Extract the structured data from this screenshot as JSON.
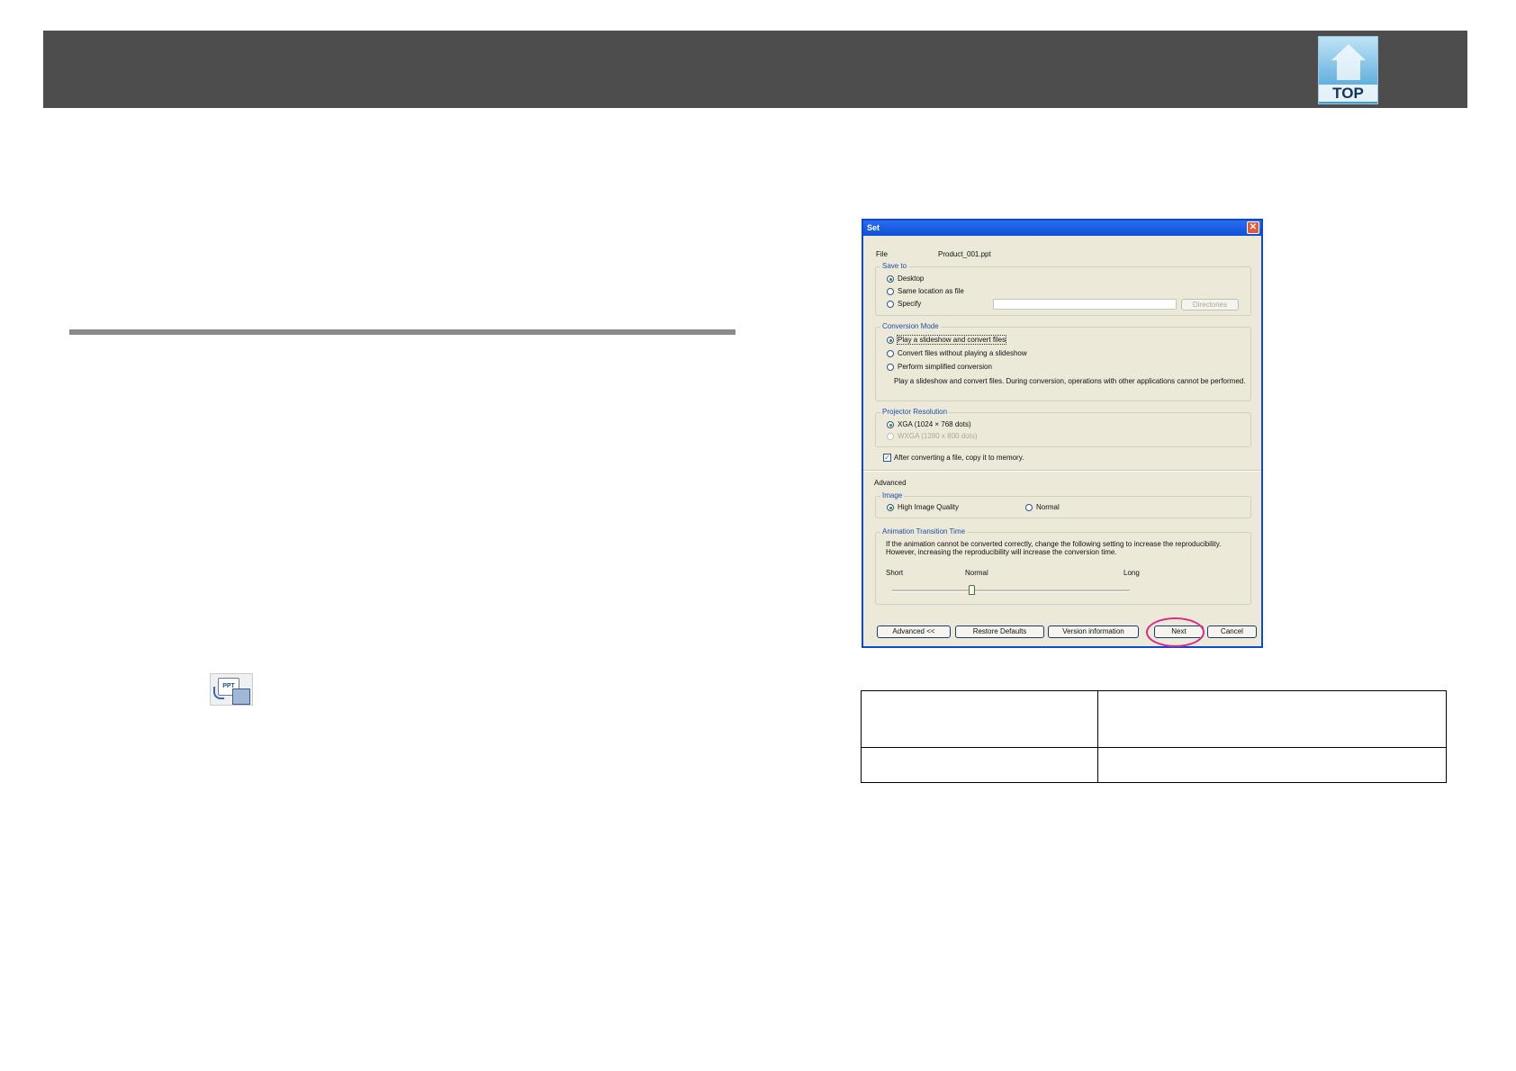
{
  "header": {
    "top_button_label": "TOP"
  },
  "icons": {
    "app_icon_text": "PPT"
  },
  "dialog": {
    "title": "Set",
    "close_glyph": "✕",
    "file_label": "File",
    "file_value": "Product_001.ppt",
    "save_to": {
      "title": "Save to",
      "options": [
        "Desktop",
        "Same location as file",
        "Specify"
      ],
      "selected": "Desktop",
      "directories_button": "Directories"
    },
    "conversion_mode": {
      "title": "Conversion Mode",
      "options": [
        "Play a slideshow and convert files",
        "Convert files without playing a slideshow",
        "Perform simplified conversion"
      ],
      "selected": "Play a slideshow and convert files",
      "description": "Play a slideshow and convert files. During conversion, operations with other applications cannot be performed."
    },
    "projector_resolution": {
      "title": "Projector Resolution",
      "options": [
        "XGA (1024 × 768 dots)",
        "WXGA (1280 x 800 dots)"
      ],
      "selected": "XGA (1024 × 768 dots)"
    },
    "copy_to_memory": {
      "label": "After converting a file, copy it to memory.",
      "checked": true
    },
    "advanced_label": "Advanced",
    "image": {
      "title": "Image",
      "options": [
        "High Image Quality",
        "Normal"
      ],
      "selected": "High Image Quality"
    },
    "animation": {
      "title": "Animation Transition Time",
      "description_1": "If the animation cannot be converted correctly, change the following setting to increase the reproducibility.",
      "description_2": "However, increasing the reproducibility will increase the conversion time.",
      "label_short": "Short",
      "label_normal": "Normal",
      "label_long": "Long",
      "value": "Normal"
    },
    "buttons": {
      "advanced": "Advanced <<",
      "restore": "Restore Defaults",
      "version": "Version information",
      "next": "Next",
      "cancel": "Cancel"
    }
  },
  "colors": {
    "header_bar": "#4d4d4d",
    "titlebar": "#0b4fd6",
    "highlight_ring": "#d62b8a"
  }
}
